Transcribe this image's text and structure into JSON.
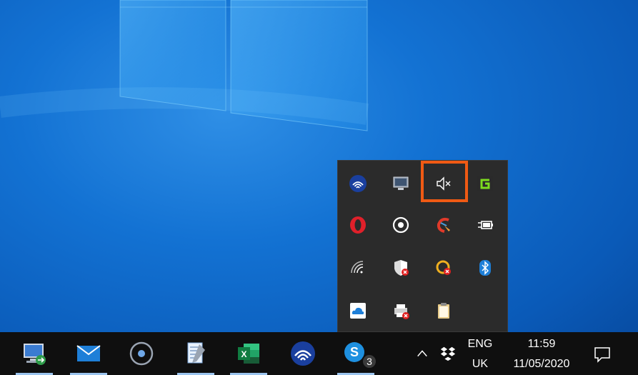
{
  "tray_overflow": {
    "icons": [
      {
        "name": "network-share-icon"
      },
      {
        "name": "display-icon"
      },
      {
        "name": "volume-muted-icon"
      },
      {
        "name": "greenshot-icon"
      },
      {
        "name": "opera-icon"
      },
      {
        "name": "cortana-ring-icon"
      },
      {
        "name": "ccleaner-icon"
      },
      {
        "name": "power-plug-icon"
      },
      {
        "name": "wifi-icon"
      },
      {
        "name": "security-shield-icon"
      },
      {
        "name": "defender-alert-icon"
      },
      {
        "name": "bluetooth-icon"
      },
      {
        "name": "onedrive-icon"
      },
      {
        "name": "printer-error-icon"
      },
      {
        "name": "clipboard-icon"
      }
    ]
  },
  "taskbar": {
    "skype_badge": "3",
    "language": {
      "code": "ENG",
      "region": "UK"
    },
    "clock": {
      "time": "11:59",
      "date": "11/05/2020"
    }
  },
  "colors": {
    "highlight": "#f05a14",
    "taskbar": "#0f0f0f",
    "popup": "#2b2b2b"
  }
}
